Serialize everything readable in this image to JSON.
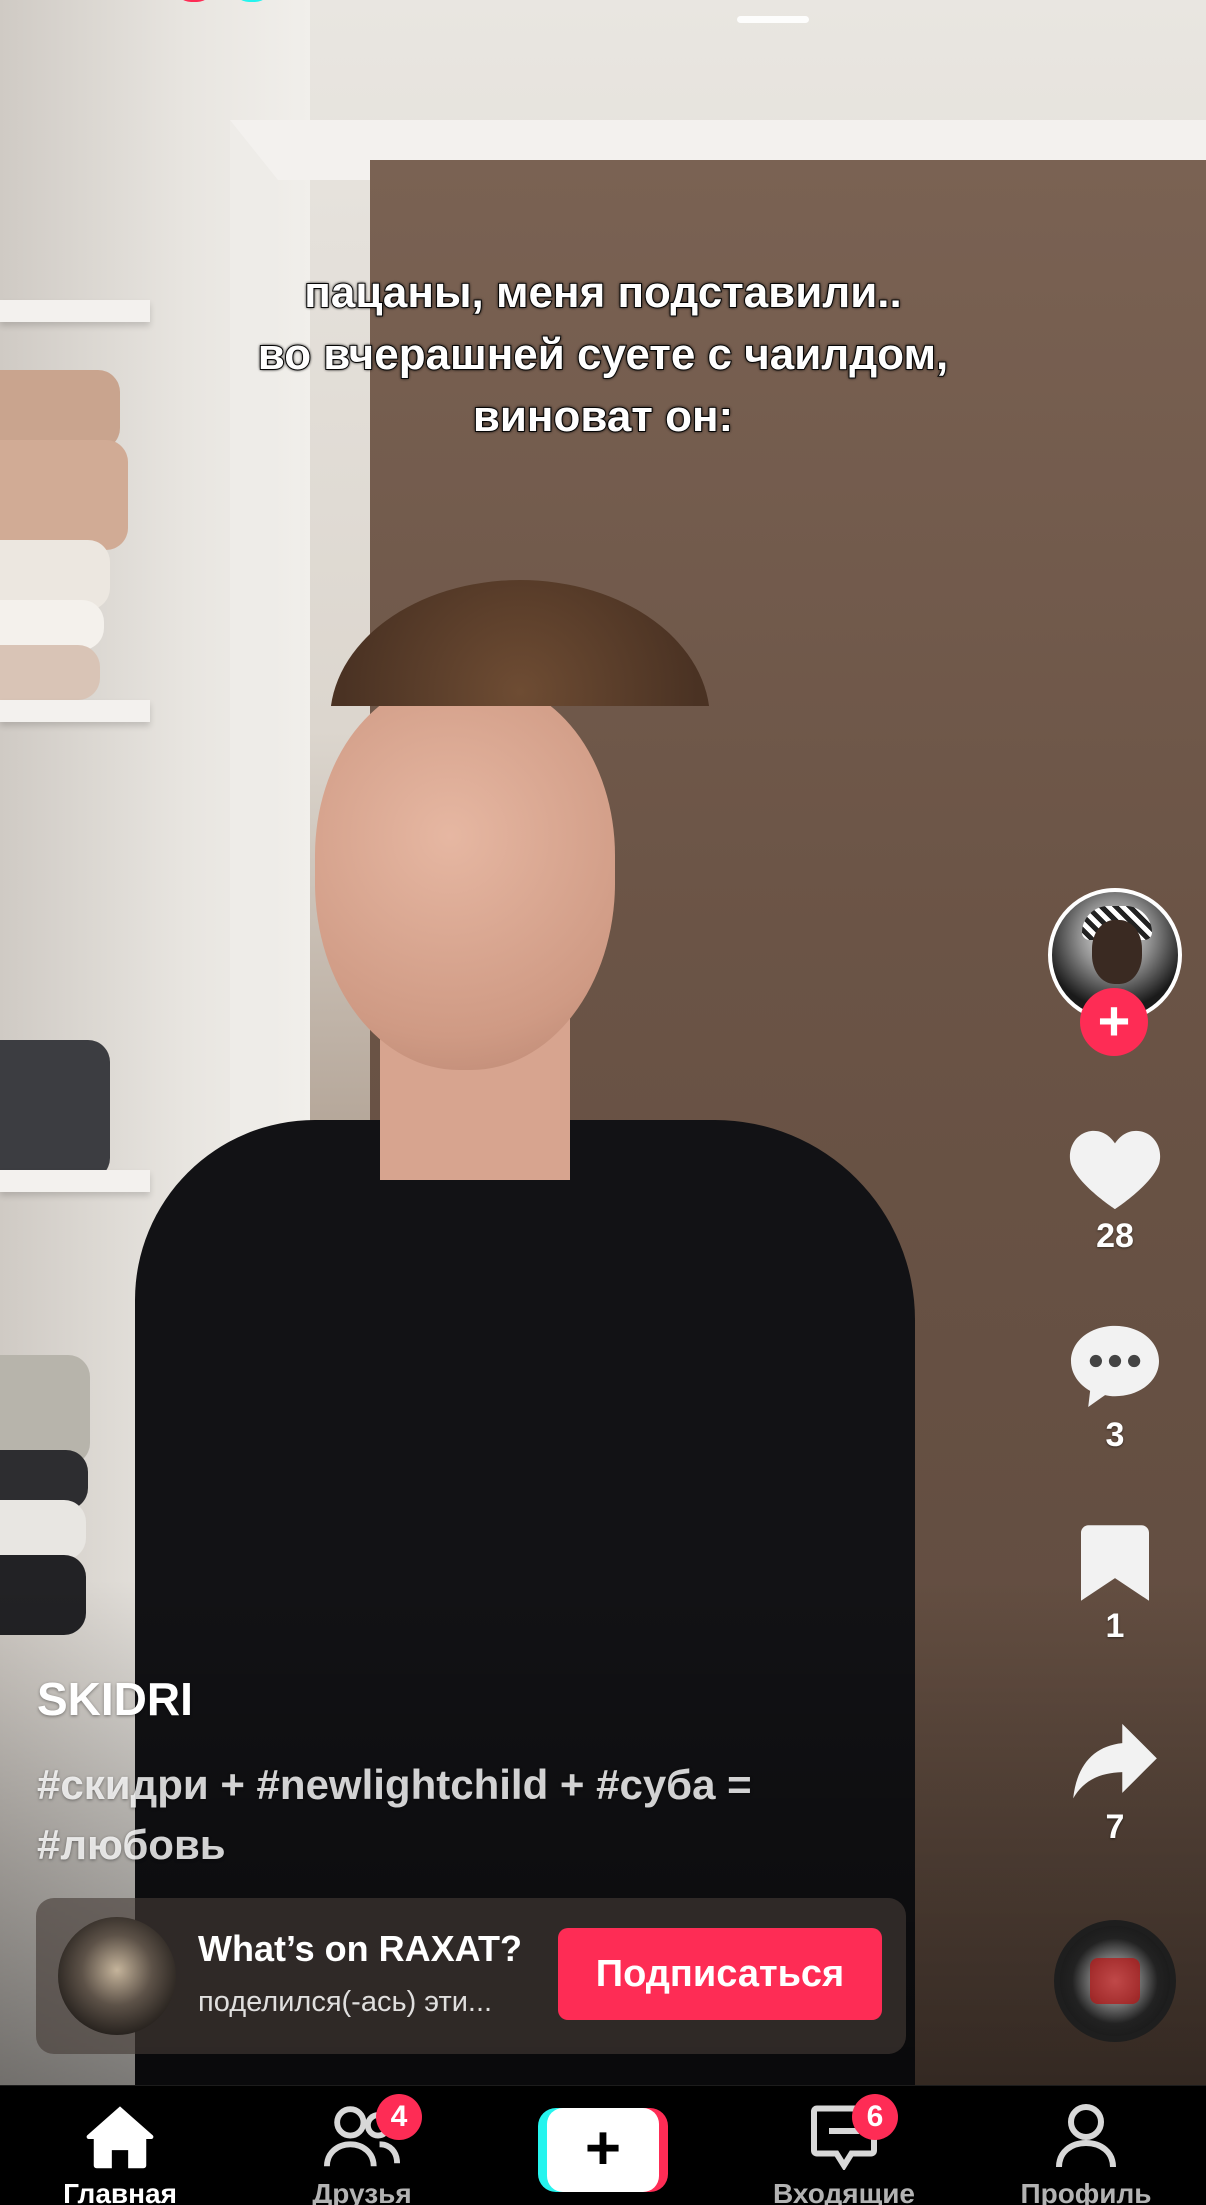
{
  "video": {
    "caption_lines": [
      "пацаны, меня подставили..",
      "во вчерашней суете с чаилдом,",
      "виноват он:"
    ]
  },
  "rail": {
    "like_count": "28",
    "comment_count": "3",
    "bookmark_count": "1",
    "share_count": "7",
    "follow_symbol": "+"
  },
  "post": {
    "author": "SKIDRI",
    "description": "#скидри + #newlightchild + #суба = #любовь"
  },
  "promo": {
    "title": "What’s on RAXAT?",
    "subtitle": "поделился(-ась) эти...",
    "button_label": "Подписаться"
  },
  "tabbar": {
    "tabs": [
      {
        "label": "Главная",
        "icon": "home-icon",
        "active": true
      },
      {
        "label": "Друзья",
        "icon": "friends-icon",
        "badge": "4"
      },
      {
        "label": "",
        "icon": "plus-icon"
      },
      {
        "label": "Входящие",
        "icon": "inbox-icon",
        "badge": "6"
      },
      {
        "label": "Профиль",
        "icon": "profile-icon"
      }
    ],
    "create_symbol": "+"
  },
  "colors": {
    "accent": "#fe2c55",
    "cyan": "#25f4ee"
  }
}
